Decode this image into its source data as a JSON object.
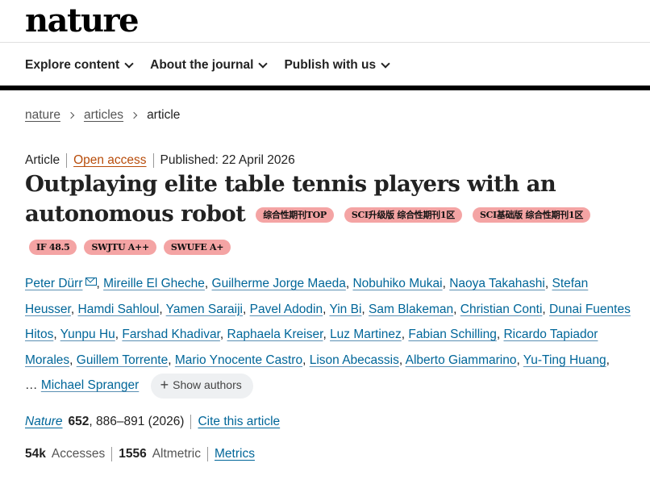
{
  "site": {
    "logo": "nature"
  },
  "nav": [
    {
      "label": "Explore content"
    },
    {
      "label": "About the journal"
    },
    {
      "label": "Publish with us"
    }
  ],
  "breadcrumb": {
    "items": [
      "nature",
      "articles"
    ],
    "current": "article"
  },
  "meta": {
    "type": "Article",
    "access": "Open access",
    "published": "Published: 22 April 2026"
  },
  "title": {
    "line1": "Outplaying elite table tennis players with an",
    "line2": "autonomous robot"
  },
  "badges_inline": [
    "综合性期刊TOP",
    "SCI升级版 综合性期刊1区",
    "SCI基础版 综合性期刊1区"
  ],
  "badges_row": [
    "IF 48.5",
    "SWJTU A++",
    "SWUFE A+"
  ],
  "authors": {
    "list": [
      "Peter Dürr",
      "Mireille El Gheche",
      "Guilherme Jorge Maeda",
      "Nobuhiko Mukai",
      "Naoya Takahashi",
      "Stefan Heusser",
      "Hamdi Sahloul",
      "Yamen Saraiji",
      "Pavel Adodin",
      "Yin Bi",
      "Sam Blakeman",
      "Christian Conti",
      "Dunai Fuentes Hitos",
      "Yunpu Hu",
      "Farshad Khadivar",
      "Raphaela Kreiser",
      "Luz Martinez",
      "Fabian Schilling",
      "Ricardo Tapiador Morales",
      "Guillem Torrente",
      "Mario Ynocente Castro",
      "Lison Abecassis",
      "Alberto Giammarino",
      "Yu-Ting Huang"
    ],
    "ellipsis": "…",
    "last": "Michael Spranger",
    "show_label": "Show authors"
  },
  "citation": {
    "journal": "Nature",
    "volume": "652",
    "pages": ", 886–891 (2026)",
    "cite_label": "Cite this article"
  },
  "stats": {
    "accesses_value": "54k",
    "accesses_label": "Accesses",
    "altmetric_value": "1556",
    "altmetric_label": "Altmetric",
    "metrics_label": "Metrics"
  },
  "colors": {
    "link": "#006699",
    "open_access": "#b84c0a",
    "badge": "#f4a4a4"
  }
}
